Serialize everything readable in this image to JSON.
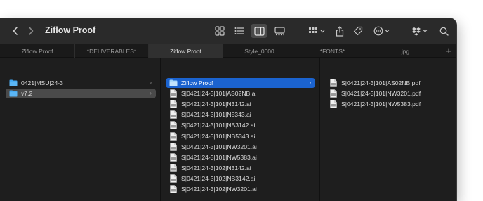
{
  "window": {
    "title": "Ziflow Proof"
  },
  "tabs": [
    {
      "label": "Ziflow Proof"
    },
    {
      "label": "*DELIVERABLES*"
    },
    {
      "label": "Ziflow Proof"
    },
    {
      "label": "Style_0000"
    },
    {
      "label": "*FONTS*"
    },
    {
      "label": "jpg"
    }
  ],
  "column1": [
    {
      "label": "0421|MSU|24-3"
    },
    {
      "label": "v7.2"
    }
  ],
  "column2": [
    {
      "label": "Ziflow Proof"
    },
    {
      "label": "S|0421|24-3|101|AS02NB.ai"
    },
    {
      "label": "S|0421|24-3|101|N3142.ai"
    },
    {
      "label": "S|0421|24-3|101|N5343.ai"
    },
    {
      "label": "S|0421|24-3|101|NB3142.ai"
    },
    {
      "label": "S|0421|24-3|101|NB5343.ai"
    },
    {
      "label": "S|0421|24-3|101|NW3201.ai"
    },
    {
      "label": "S|0421|24-3|101|NW5383.ai"
    },
    {
      "label": "S|0421|24-3|102|N3142.ai"
    },
    {
      "label": "S|0421|24-3|102|NB3142.ai"
    },
    {
      "label": "S|0421|24-3|102|NW3201.ai"
    }
  ],
  "column3": [
    {
      "label": "S|0421|24-3|101|AS02NB.pdf"
    },
    {
      "label": "S|0421|24-3|101|NW3201.pdf"
    },
    {
      "label": "S|0421|24-3|101|NW5383.pdf"
    }
  ],
  "colors": {
    "accent": "#1b63cf",
    "folder": "#3ea6f2",
    "window": "#1e1e1e"
  }
}
